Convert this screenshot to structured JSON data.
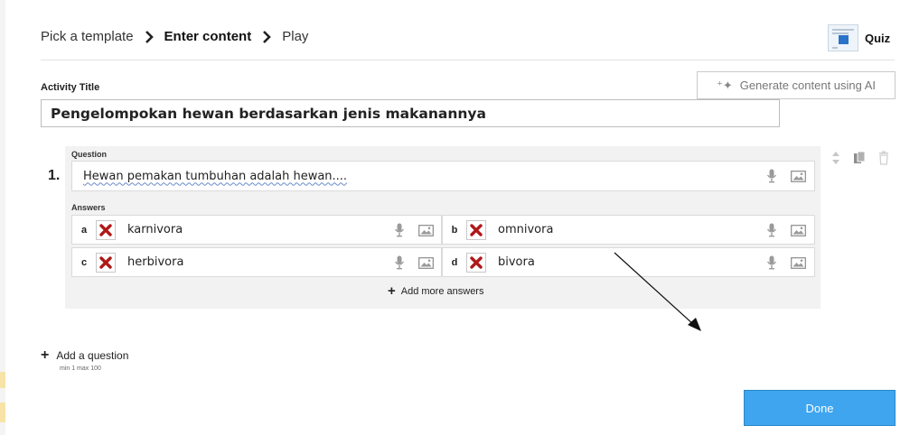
{
  "breadcrumb": {
    "steps": [
      "Pick a template",
      "Enter content",
      "Play"
    ]
  },
  "template": {
    "name": "Quiz",
    "icon": "quiz-template-thumbnail-icon"
  },
  "activity": {
    "label": "Activity Title",
    "title": "Pengelompokan hewan berdasarkan jenis makanannya"
  },
  "generate": {
    "label": "Generate content using AI",
    "icon": "sparkle-icon"
  },
  "question": {
    "number": "1.",
    "label": "Question",
    "text": "Hewan pemakan tumbuhan adalah hewan....",
    "answers_label": "Answers",
    "answers": [
      {
        "letter": "a",
        "text": "karnivora",
        "status_icon": "cross-icon"
      },
      {
        "letter": "b",
        "text": "omnivora",
        "status_icon": "cross-icon"
      },
      {
        "letter": "c",
        "text": "herbivora",
        "status_icon": "cross-icon"
      },
      {
        "letter": "d",
        "text": "bivora",
        "status_icon": "cross-icon"
      }
    ],
    "add_more_label": "Add more answers"
  },
  "add_question": {
    "label": "Add a question",
    "limits": "min 1   max 100"
  },
  "done_label": "Done",
  "colors": {
    "accent": "#3ea5ee",
    "wrong": "#b01818",
    "panel": "#f2f2f2"
  }
}
